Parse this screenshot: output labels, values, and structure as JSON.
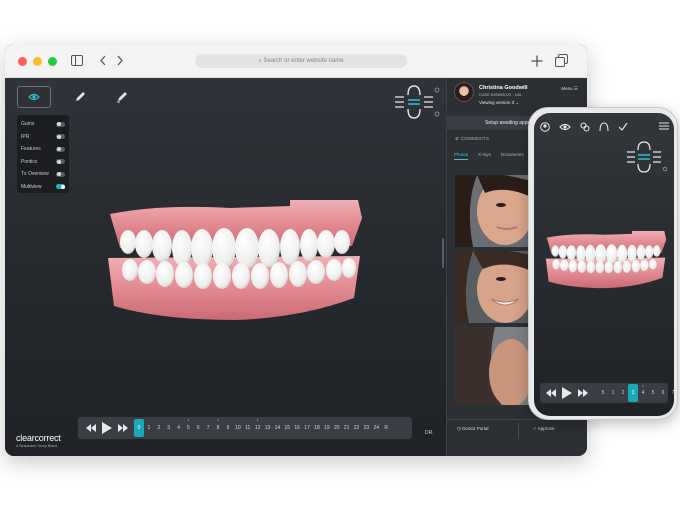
{
  "browser": {
    "url_placeholder": "Search or enter website name"
  },
  "toolbar": {
    "tools": [
      "eye-icon",
      "pencil-icon",
      "pen-icon"
    ]
  },
  "layers": [
    {
      "label": "Gums",
      "on": false
    },
    {
      "label": "IPR",
      "on": false
    },
    {
      "label": "Features",
      "on": false
    },
    {
      "label": "Pontics",
      "on": false
    },
    {
      "label": "Tx Overview",
      "on": false
    },
    {
      "label": "Multiview",
      "on": true
    }
  ],
  "brand": {
    "name": "clearcorrect",
    "tagline": "A Straumann Group Brand"
  },
  "timeline": {
    "steps": [
      "0",
      "1",
      "2",
      "3",
      "4",
      "5",
      "6",
      "7",
      "8",
      "9",
      "10",
      "11",
      "12",
      "13",
      "14",
      "15",
      "16",
      "17",
      "18",
      "19",
      "20",
      "21",
      "22",
      "23",
      "24",
      "R"
    ],
    "current": "0",
    "markers": [
      "5",
      "8",
      "12"
    ],
    "end_label": "DR."
  },
  "patient": {
    "name": "Christina Goodwill",
    "case": "CASE 839893023 · UAL",
    "version": "Viewing version 3",
    "menu": "Menu"
  },
  "panel": {
    "status": "Setup awaiting approval",
    "comments": "COMMENTS",
    "tabs": [
      "Photos",
      "X-rays",
      "Documents"
    ],
    "doctor_portal": "Doctor Portal",
    "approve": "Approve"
  },
  "phone_timeline": {
    "steps": [
      "5",
      "1",
      "2",
      "3",
      "4",
      "5",
      "6",
      "7"
    ],
    "current": "3",
    "markers": [
      "4"
    ]
  },
  "colors": {
    "accent": "#19a9b8",
    "gum": "#e8959b",
    "tooth": "#f4f4f2"
  }
}
